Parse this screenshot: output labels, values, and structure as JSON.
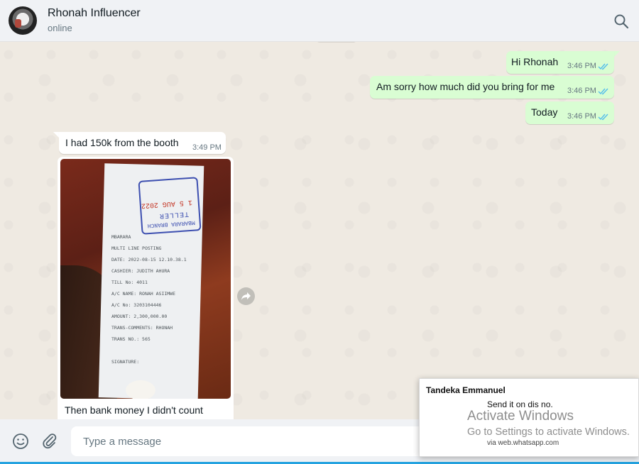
{
  "header": {
    "contact_name": "Rhonah Influencer",
    "status": "online",
    "search_icon": "search-icon"
  },
  "messages": [
    {
      "direction": "outgoing",
      "text": "Hi Rhonah",
      "time": "3:46 PM",
      "status": "read"
    },
    {
      "direction": "outgoing",
      "text": "Am sorry how much did you bring for me",
      "time": "3:46 PM",
      "status": "read"
    },
    {
      "direction": "outgoing",
      "text": "Today",
      "time": "3:46 PM",
      "status": "read"
    },
    {
      "direction": "incoming",
      "text": "I had 150k from the booth",
      "time": "3:49 PM"
    },
    {
      "direction": "incoming",
      "type": "image",
      "caption": "Then bank money I didn't count",
      "image": {
        "stamp_branch": "MBARARA BRANCH",
        "stamp_teller": "TELLER",
        "stamp_date": "1 5 AUG 2022",
        "receipt_lines": [
          "MBARARA",
          "MULTI LINE POSTING",
          "DATE:    2022-08-15 12.10.38.1",
          "CASHIER:  JUDITH AHURA",
          "TILL No:  4011",
          "A/C NAME: RONAH ASIIMWE",
          "A/C No:   3203104446",
          "AMOUNT:   2,300,000.00",
          "TRANS-COMMENTS: RHONAH",
          "TRANS NO.:  565",
          "",
          "SIGNATURE:"
        ]
      }
    }
  ],
  "composer": {
    "placeholder": "Type a message",
    "emoji_icon": "emoji-icon",
    "attach_icon": "paperclip-icon"
  },
  "notification": {
    "sender": "Tandeka Emmanuel",
    "message": "Send it on dis no.",
    "via": "via web.whatsapp.com"
  },
  "watermark": {
    "title": "Activate Windows",
    "subtitle": "Go to Settings to activate Windows."
  },
  "colors": {
    "outgoing_bubble": "#d9fdd3",
    "incoming_bubble": "#ffffff",
    "chat_background": "#efeae2",
    "read_ticks": "#53bdeb"
  }
}
